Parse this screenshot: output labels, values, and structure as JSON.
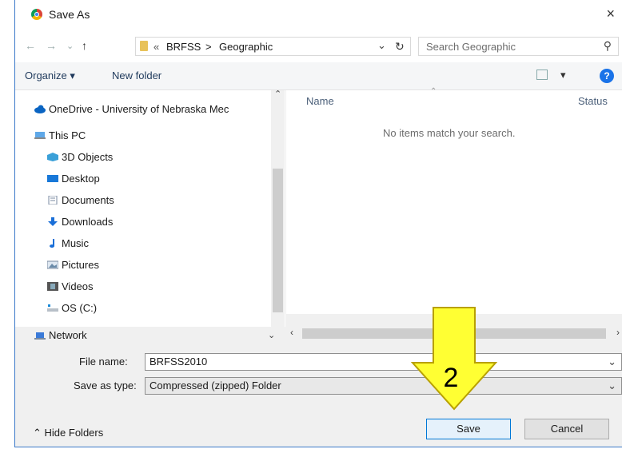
{
  "window": {
    "title": "Save As",
    "close_icon": "×"
  },
  "address": {
    "crumb_prefix": "«",
    "crumbs": [
      "BRFSS",
      ">",
      "Geographic"
    ],
    "search_placeholder": "Search Geographic"
  },
  "toolbar": {
    "organize": "Organize ▾",
    "new_folder": "New folder",
    "help": "?"
  },
  "nav": {
    "items": [
      {
        "label": "OneDrive - University of Nebraska Mec"
      },
      {
        "label": "This PC"
      },
      {
        "label": "3D Objects"
      },
      {
        "label": "Desktop"
      },
      {
        "label": "Documents"
      },
      {
        "label": "Downloads"
      },
      {
        "label": "Music"
      },
      {
        "label": "Pictures"
      },
      {
        "label": "Videos"
      },
      {
        "label": "OS (C:)"
      },
      {
        "label": "Network"
      }
    ]
  },
  "content": {
    "columns": [
      "Name",
      "Status"
    ],
    "empty_message": "No items match your search."
  },
  "form": {
    "file_name_label": "File name:",
    "file_name_value": "BRFSS2010",
    "type_label": "Save as type:",
    "type_value": "Compressed (zipped) Folder"
  },
  "buttons": {
    "save": "Save",
    "cancel": "Cancel",
    "hide_folders": "Hide Folders"
  },
  "annotation": {
    "step_number": "2",
    "arrow_color": "#ffff33"
  },
  "colors": {
    "accent": "#0078d7",
    "folder": "#e8c25a"
  }
}
